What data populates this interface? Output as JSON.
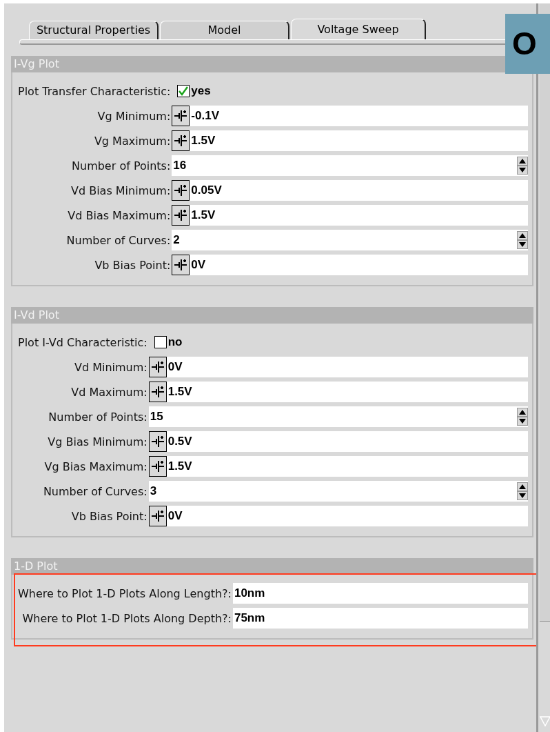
{
  "tabs": [
    {
      "label": "Structural Properties",
      "selected": false
    },
    {
      "label": "Model",
      "selected": false
    },
    {
      "label": "Voltage Sweep",
      "selected": true
    }
  ],
  "badge": {
    "label": "O"
  },
  "sections": [
    {
      "title": "I-Vg Plot",
      "highlighted": false,
      "fields": [
        {
          "kind": "check",
          "label": "Plot Transfer Characteristic:",
          "checked": true,
          "value": "yes"
        },
        {
          "kind": "voltage",
          "label": "Vg Minimum:",
          "value": "-0.1V"
        },
        {
          "kind": "voltage",
          "label": "Vg Maximum:",
          "value": "1.5V"
        },
        {
          "kind": "spin",
          "label": "Number of Points:",
          "value": "16"
        },
        {
          "kind": "voltage",
          "label": "Vd Bias Minimum:",
          "value": "0.05V"
        },
        {
          "kind": "voltage",
          "label": "Vd Bias Maximum:",
          "value": "1.5V"
        },
        {
          "kind": "spin",
          "label": "Number of Curves:",
          "value": "2"
        },
        {
          "kind": "voltage",
          "label": "Vb Bias Point:",
          "value": "0V"
        }
      ]
    },
    {
      "title": "I-Vd Plot",
      "highlighted": false,
      "fields": [
        {
          "kind": "check",
          "label": "Plot I-Vd Characteristic:",
          "checked": false,
          "value": "no"
        },
        {
          "kind": "voltage",
          "label": "Vd Minimum:",
          "value": "0V"
        },
        {
          "kind": "voltage",
          "label": "Vd Maximum:",
          "value": "1.5V"
        },
        {
          "kind": "spin",
          "label": "Number of Points:",
          "value": "15"
        },
        {
          "kind": "voltage",
          "label": "Vg Bias Minimum:",
          "value": "0.5V"
        },
        {
          "kind": "voltage",
          "label": "Vg Bias Maximum:",
          "value": "1.5V"
        },
        {
          "kind": "spin",
          "label": "Number of Curves:",
          "value": "3"
        },
        {
          "kind": "voltage",
          "label": "Vb Bias Point:",
          "value": "0V"
        }
      ]
    },
    {
      "title": "1-D Plot",
      "highlighted": true,
      "fields": [
        {
          "kind": "text",
          "label": "Where to Plot 1-D Plots Along Length?:",
          "value": "10nm"
        },
        {
          "kind": "text",
          "label": "Where to Plot 1-D Plots Along Depth?:",
          "value": "75nm"
        }
      ]
    }
  ]
}
